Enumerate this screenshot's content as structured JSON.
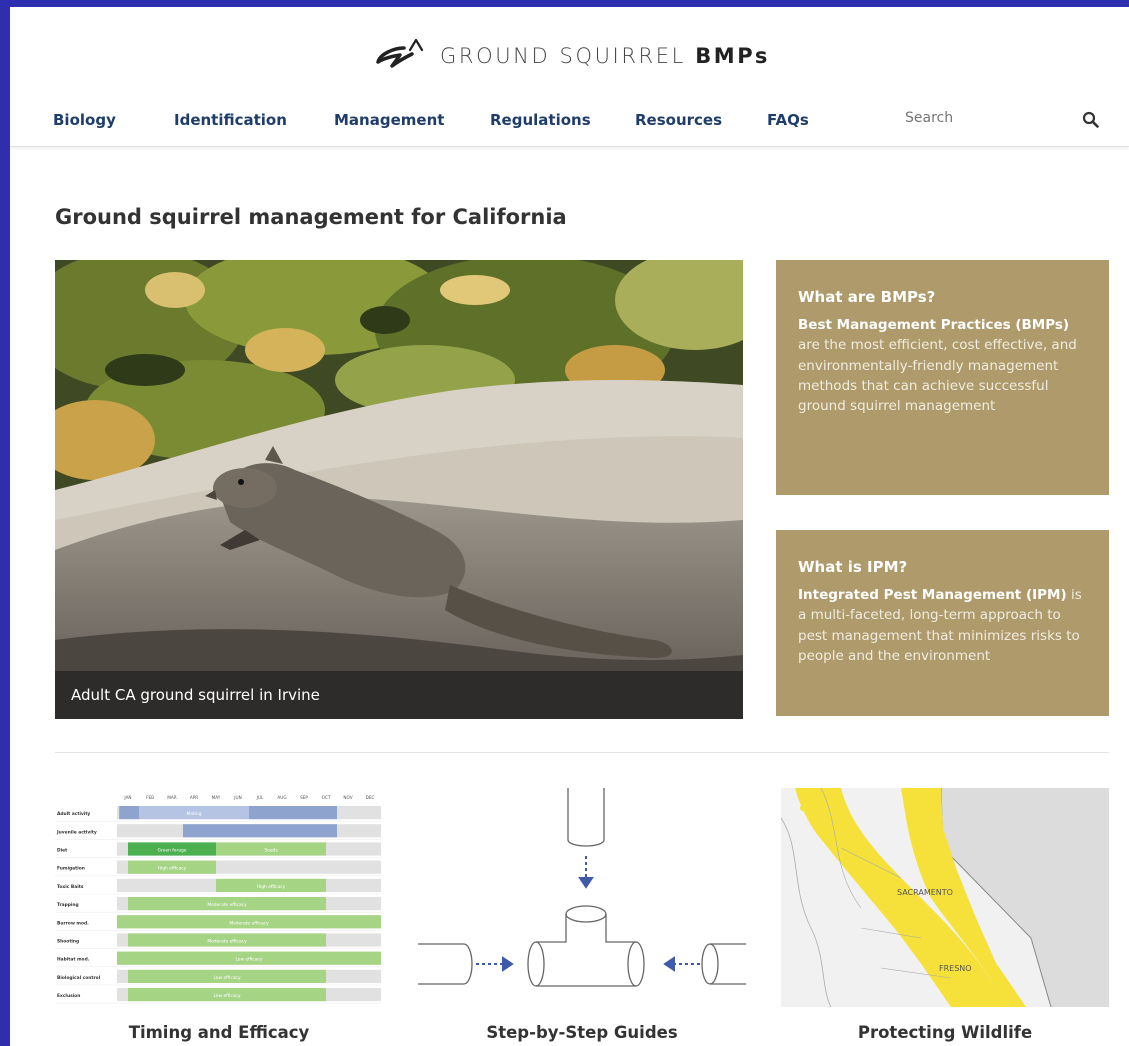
{
  "site": {
    "logo_text": "GROUND SQUIRREL",
    "logo_bold": "BMPs"
  },
  "nav": {
    "items": [
      "Biology",
      "Identification",
      "Management",
      "Regulations",
      "Resources",
      "FAQs"
    ],
    "search_placeholder": "Search"
  },
  "page_title": "Ground squirrel management for California",
  "hero": {
    "caption": "Adult CA ground squirrel in Irvine"
  },
  "bmps_card": {
    "title": "What are BMPs?",
    "lead_bold": "Best Management Practices (BMPs)",
    "text": " are the most efficient, cost effective, and environmentally-friendly management methods that can achieve successful ground squirrel management"
  },
  "ipm_card": {
    "title": "What is IPM?",
    "lead_bold": "Integrated Pest Management (IPM)",
    "text": " is a multi-faceted, long-term approach to pest management that minimizes risks to people and the environment"
  },
  "features": [
    {
      "label": "Timing and Efficacy",
      "icon": "timing-chart-thumbnail"
    },
    {
      "label": "Step-by-Step Guides",
      "icon": "pipe-fitting-diagram"
    },
    {
      "label": "Protecting Wildlife",
      "icon": "california-range-map"
    }
  ],
  "timing_chart": {
    "months": [
      "JAN",
      "FEB",
      "MAR",
      "APR",
      "MAY",
      "JUN",
      "JUL",
      "AUG",
      "SEP",
      "OCT",
      "NOV",
      "DEC"
    ],
    "rows": [
      {
        "name": "Adult activity",
        "bars": [
          {
            "start": 0.1,
            "end": 1,
            "color": "#8fa3cf",
            "text": ""
          },
          {
            "start": 1,
            "end": 6,
            "color": "#b6c4e3",
            "text": "Mating"
          },
          {
            "start": 6,
            "end": 10,
            "color": "#8fa3cf",
            "text": ""
          }
        ]
      },
      {
        "name": "Juvenile activity",
        "bars": [
          {
            "start": 3,
            "end": 10,
            "color": "#8fa3cf",
            "text": ""
          }
        ]
      },
      {
        "name": "Diet",
        "bars": [
          {
            "start": 0.5,
            "end": 4.5,
            "color": "#4caf50",
            "text": "Green forage"
          },
          {
            "start": 4.5,
            "end": 9.5,
            "color": "#a6d485",
            "text": "Seeds"
          }
        ]
      },
      {
        "name": "Fumigation",
        "bars": [
          {
            "start": 0.5,
            "end": 4.5,
            "color": "#a6d485",
            "text": "High efficacy"
          }
        ]
      },
      {
        "name": "Toxic Baits",
        "bars": [
          {
            "start": 4.5,
            "end": 9.5,
            "color": "#a6d485",
            "text": "High efficacy"
          }
        ]
      },
      {
        "name": "Trapping",
        "bars": [
          {
            "start": 0.5,
            "end": 9.5,
            "color": "#a6d485",
            "text": "Moderate efficacy"
          }
        ]
      },
      {
        "name": "Burrow mod.",
        "bars": [
          {
            "start": 0,
            "end": 12,
            "color": "#a6d485",
            "text": "Moderate efficacy"
          }
        ]
      },
      {
        "name": "Shooting",
        "bars": [
          {
            "start": 0.5,
            "end": 9.5,
            "color": "#a6d485",
            "text": "Moderate efficacy"
          }
        ]
      },
      {
        "name": "Habitat mod.",
        "bars": [
          {
            "start": 0,
            "end": 12,
            "color": "#a6d485",
            "text": "Low efficacy"
          }
        ]
      },
      {
        "name": "Biological control",
        "bars": [
          {
            "start": 0.5,
            "end": 9.5,
            "color": "#a6d485",
            "text": "Low efficacy"
          }
        ]
      },
      {
        "name": "Exclusion",
        "bars": [
          {
            "start": 0.5,
            "end": 9.5,
            "color": "#a6d485",
            "text": "Low efficacy"
          }
        ]
      }
    ]
  },
  "map_labels": {
    "city1": "SACRAMENTO",
    "city2": "FRESNO"
  },
  "colors": {
    "nav_link": "#1f3d6b",
    "card_bg": "#ae9a6b",
    "frame_border": "#2d2fb0",
    "range_yellow": "#f5e13a"
  }
}
